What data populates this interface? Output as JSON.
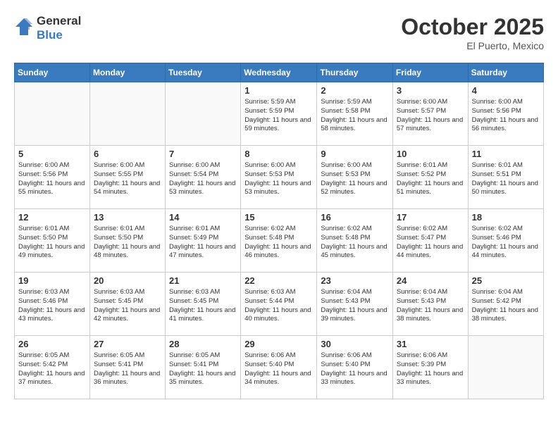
{
  "header": {
    "logo_general": "General",
    "logo_blue": "Blue",
    "month": "October 2025",
    "location": "El Puerto, Mexico"
  },
  "weekdays": [
    "Sunday",
    "Monday",
    "Tuesday",
    "Wednesday",
    "Thursday",
    "Friday",
    "Saturday"
  ],
  "weeks": [
    [
      {
        "day": "",
        "content": ""
      },
      {
        "day": "",
        "content": ""
      },
      {
        "day": "",
        "content": ""
      },
      {
        "day": "1",
        "content": "Sunrise: 5:59 AM\nSunset: 5:59 PM\nDaylight: 11 hours and 59 minutes."
      },
      {
        "day": "2",
        "content": "Sunrise: 5:59 AM\nSunset: 5:58 PM\nDaylight: 11 hours and 58 minutes."
      },
      {
        "day": "3",
        "content": "Sunrise: 6:00 AM\nSunset: 5:57 PM\nDaylight: 11 hours and 57 minutes."
      },
      {
        "day": "4",
        "content": "Sunrise: 6:00 AM\nSunset: 5:56 PM\nDaylight: 11 hours and 56 minutes."
      }
    ],
    [
      {
        "day": "5",
        "content": "Sunrise: 6:00 AM\nSunset: 5:56 PM\nDaylight: 11 hours and 55 minutes."
      },
      {
        "day": "6",
        "content": "Sunrise: 6:00 AM\nSunset: 5:55 PM\nDaylight: 11 hours and 54 minutes."
      },
      {
        "day": "7",
        "content": "Sunrise: 6:00 AM\nSunset: 5:54 PM\nDaylight: 11 hours and 53 minutes."
      },
      {
        "day": "8",
        "content": "Sunrise: 6:00 AM\nSunset: 5:53 PM\nDaylight: 11 hours and 53 minutes."
      },
      {
        "day": "9",
        "content": "Sunrise: 6:00 AM\nSunset: 5:53 PM\nDaylight: 11 hours and 52 minutes."
      },
      {
        "day": "10",
        "content": "Sunrise: 6:01 AM\nSunset: 5:52 PM\nDaylight: 11 hours and 51 minutes."
      },
      {
        "day": "11",
        "content": "Sunrise: 6:01 AM\nSunset: 5:51 PM\nDaylight: 11 hours and 50 minutes."
      }
    ],
    [
      {
        "day": "12",
        "content": "Sunrise: 6:01 AM\nSunset: 5:50 PM\nDaylight: 11 hours and 49 minutes."
      },
      {
        "day": "13",
        "content": "Sunrise: 6:01 AM\nSunset: 5:50 PM\nDaylight: 11 hours and 48 minutes."
      },
      {
        "day": "14",
        "content": "Sunrise: 6:01 AM\nSunset: 5:49 PM\nDaylight: 11 hours and 47 minutes."
      },
      {
        "day": "15",
        "content": "Sunrise: 6:02 AM\nSunset: 5:48 PM\nDaylight: 11 hours and 46 minutes."
      },
      {
        "day": "16",
        "content": "Sunrise: 6:02 AM\nSunset: 5:48 PM\nDaylight: 11 hours and 45 minutes."
      },
      {
        "day": "17",
        "content": "Sunrise: 6:02 AM\nSunset: 5:47 PM\nDaylight: 11 hours and 44 minutes."
      },
      {
        "day": "18",
        "content": "Sunrise: 6:02 AM\nSunset: 5:46 PM\nDaylight: 11 hours and 44 minutes."
      }
    ],
    [
      {
        "day": "19",
        "content": "Sunrise: 6:03 AM\nSunset: 5:46 PM\nDaylight: 11 hours and 43 minutes."
      },
      {
        "day": "20",
        "content": "Sunrise: 6:03 AM\nSunset: 5:45 PM\nDaylight: 11 hours and 42 minutes."
      },
      {
        "day": "21",
        "content": "Sunrise: 6:03 AM\nSunset: 5:45 PM\nDaylight: 11 hours and 41 minutes."
      },
      {
        "day": "22",
        "content": "Sunrise: 6:03 AM\nSunset: 5:44 PM\nDaylight: 11 hours and 40 minutes."
      },
      {
        "day": "23",
        "content": "Sunrise: 6:04 AM\nSunset: 5:43 PM\nDaylight: 11 hours and 39 minutes."
      },
      {
        "day": "24",
        "content": "Sunrise: 6:04 AM\nSunset: 5:43 PM\nDaylight: 11 hours and 38 minutes."
      },
      {
        "day": "25",
        "content": "Sunrise: 6:04 AM\nSunset: 5:42 PM\nDaylight: 11 hours and 38 minutes."
      }
    ],
    [
      {
        "day": "26",
        "content": "Sunrise: 6:05 AM\nSunset: 5:42 PM\nDaylight: 11 hours and 37 minutes."
      },
      {
        "day": "27",
        "content": "Sunrise: 6:05 AM\nSunset: 5:41 PM\nDaylight: 11 hours and 36 minutes."
      },
      {
        "day": "28",
        "content": "Sunrise: 6:05 AM\nSunset: 5:41 PM\nDaylight: 11 hours and 35 minutes."
      },
      {
        "day": "29",
        "content": "Sunrise: 6:06 AM\nSunset: 5:40 PM\nDaylight: 11 hours and 34 minutes."
      },
      {
        "day": "30",
        "content": "Sunrise: 6:06 AM\nSunset: 5:40 PM\nDaylight: 11 hours and 33 minutes."
      },
      {
        "day": "31",
        "content": "Sunrise: 6:06 AM\nSunset: 5:39 PM\nDaylight: 11 hours and 33 minutes."
      },
      {
        "day": "",
        "content": ""
      }
    ]
  ]
}
